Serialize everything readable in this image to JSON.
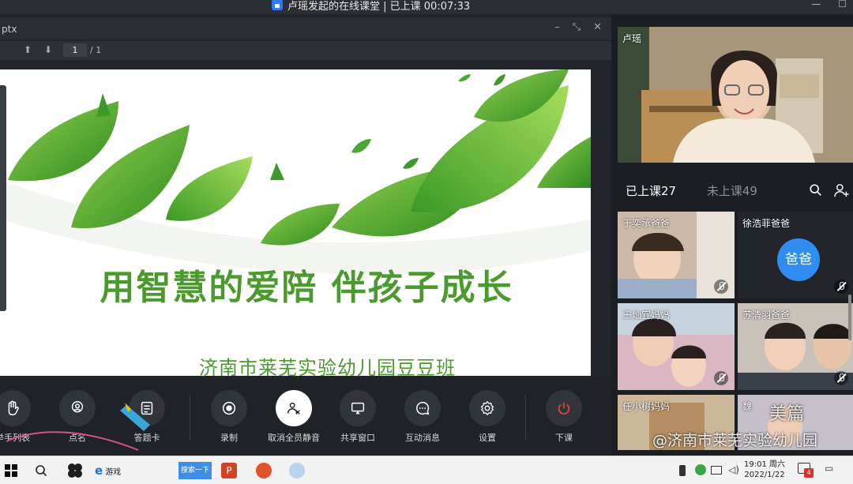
{
  "window": {
    "title": "卢瑶发起的在线课堂 | 已上课 00:07:33"
  },
  "viewer": {
    "file_name": "ptx",
    "current_page": "1",
    "total_pages": "/ 1"
  },
  "slide": {
    "title": "用智慧的爱陪 伴孩子成长",
    "subtitle": "济南市莱芜实验幼儿园豆豆班",
    "accent_color": "#4a9a2e"
  },
  "toolbar": {
    "items": [
      {
        "label": "举手列表",
        "icon": "raise-hand-icon"
      },
      {
        "label": "点名",
        "icon": "roll-call-icon"
      },
      {
        "label": "答题卡",
        "icon": "answer-card-icon"
      },
      {
        "label": "录制",
        "icon": "record-icon"
      },
      {
        "label": "取消全员静音",
        "icon": "unmute-all-icon"
      },
      {
        "label": "共享窗口",
        "icon": "share-window-icon"
      },
      {
        "label": "互动消息",
        "icon": "chat-icon"
      },
      {
        "label": "设置",
        "icon": "settings-icon"
      },
      {
        "label": "下课",
        "icon": "end-class-icon"
      }
    ],
    "end_color": "#e8453c"
  },
  "teacher": {
    "name": "卢瑶"
  },
  "attendance": {
    "in_class": "已上课27",
    "not_in_class": "未上课49"
  },
  "students": [
    {
      "name": "于奕承爸爸"
    },
    {
      "name": "徐浩菲爸爸",
      "avatar_text": "爸爸"
    },
    {
      "name": "王灿宜妈妈"
    },
    {
      "name": "苏清羽爸爸"
    },
    {
      "name": "任小树妈妈"
    },
    {
      "name": "魏"
    }
  ],
  "watermarks": {
    "brand": "美篇",
    "account": "@济南市莱芜实验幼儿园"
  },
  "taskbar": {
    "browser_label": "游戏",
    "search_button": "搜索一下",
    "time": "19:01 周六",
    "date": "2022/1/22",
    "notification_count": "4"
  }
}
